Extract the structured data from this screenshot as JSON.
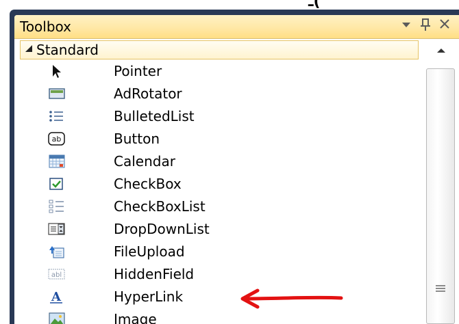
{
  "window": {
    "title": "Toolbox",
    "controls": {
      "dropdown": "▼",
      "pin": "ᵖ",
      "close": "✕"
    }
  },
  "category": {
    "label": "Standard",
    "expanded": true
  },
  "items": [
    {
      "label": "Pointer",
      "icon": "pointer-icon"
    },
    {
      "label": "AdRotator",
      "icon": "adrotator-icon"
    },
    {
      "label": "BulletedList",
      "icon": "bulleted-list-icon"
    },
    {
      "label": "Button",
      "icon": "button-icon"
    },
    {
      "label": "Calendar",
      "icon": "calendar-icon"
    },
    {
      "label": "CheckBox",
      "icon": "checkbox-icon"
    },
    {
      "label": "CheckBoxList",
      "icon": "checkbox-list-icon"
    },
    {
      "label": "DropDownList",
      "icon": "dropdown-list-icon"
    },
    {
      "label": "FileUpload",
      "icon": "file-upload-icon"
    },
    {
      "label": "HiddenField",
      "icon": "hidden-field-icon"
    },
    {
      "label": "HyperLink",
      "icon": "hyperlink-icon"
    },
    {
      "label": "Image",
      "icon": "image-icon"
    }
  ],
  "icon_text": {
    "button": "ab",
    "hidden_field": "abl",
    "hyperlink": "A"
  },
  "colors": {
    "frame": "#293955",
    "titlebar": "#ffe8a6",
    "arrow": "#e31212"
  }
}
